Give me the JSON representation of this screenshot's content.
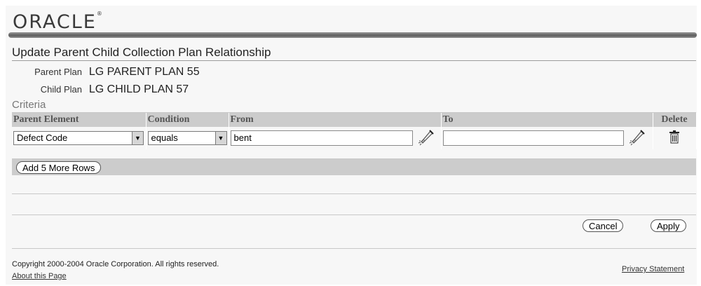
{
  "header": {
    "logo_text": "ORACLE",
    "logo_mark": "®"
  },
  "page": {
    "title": "Update Parent Child Collection Plan Relationship"
  },
  "info": {
    "parent_plan_label": "Parent Plan",
    "parent_plan_value": "LG PARENT PLAN 55",
    "child_plan_label": "Child Plan",
    "child_plan_value": "LG CHILD PLAN 57"
  },
  "criteria": {
    "heading": "Criteria",
    "columns": {
      "parent_element": "Parent Element",
      "condition": "Condition",
      "from": "From",
      "to": "To",
      "delete": "Delete"
    },
    "rows": [
      {
        "parent_element": "Defect Code",
        "condition": "equals",
        "from": "bent",
        "to": ""
      }
    ],
    "add_rows_label": "Add 5 More Rows"
  },
  "actions": {
    "cancel_label": "Cancel",
    "apply_label": "Apply"
  },
  "footer": {
    "copyright": "Copyright 2000-2004 Oracle Corporation. All rights reserved.",
    "about_link": "About this Page",
    "privacy_link": "Privacy Statement"
  },
  "colors": {
    "brand_bar": "#6e6e6e",
    "table_header": "#cccccc",
    "background": "#f7f7f7"
  },
  "icons": {
    "lov": "flashlight-search-icon",
    "delete": "trash-icon",
    "dropdown": "chevron-down-icon"
  }
}
